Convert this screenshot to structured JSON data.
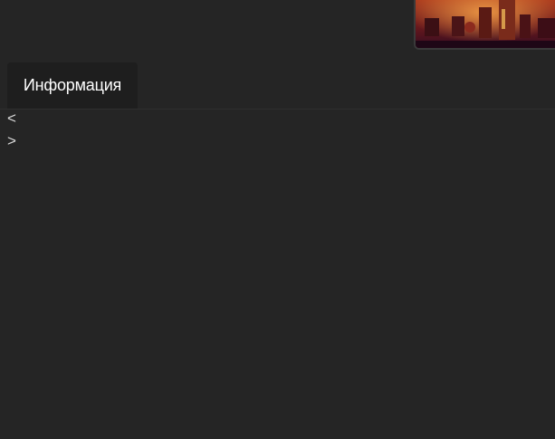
{
  "tabs": [
    {
      "label": "Информация"
    }
  ],
  "nav": {
    "prev_label": "<",
    "next_label": ">"
  },
  "colors": {
    "background": "#252525",
    "tab_background": "#1e1e1e",
    "tab_text": "#ffffff"
  }
}
